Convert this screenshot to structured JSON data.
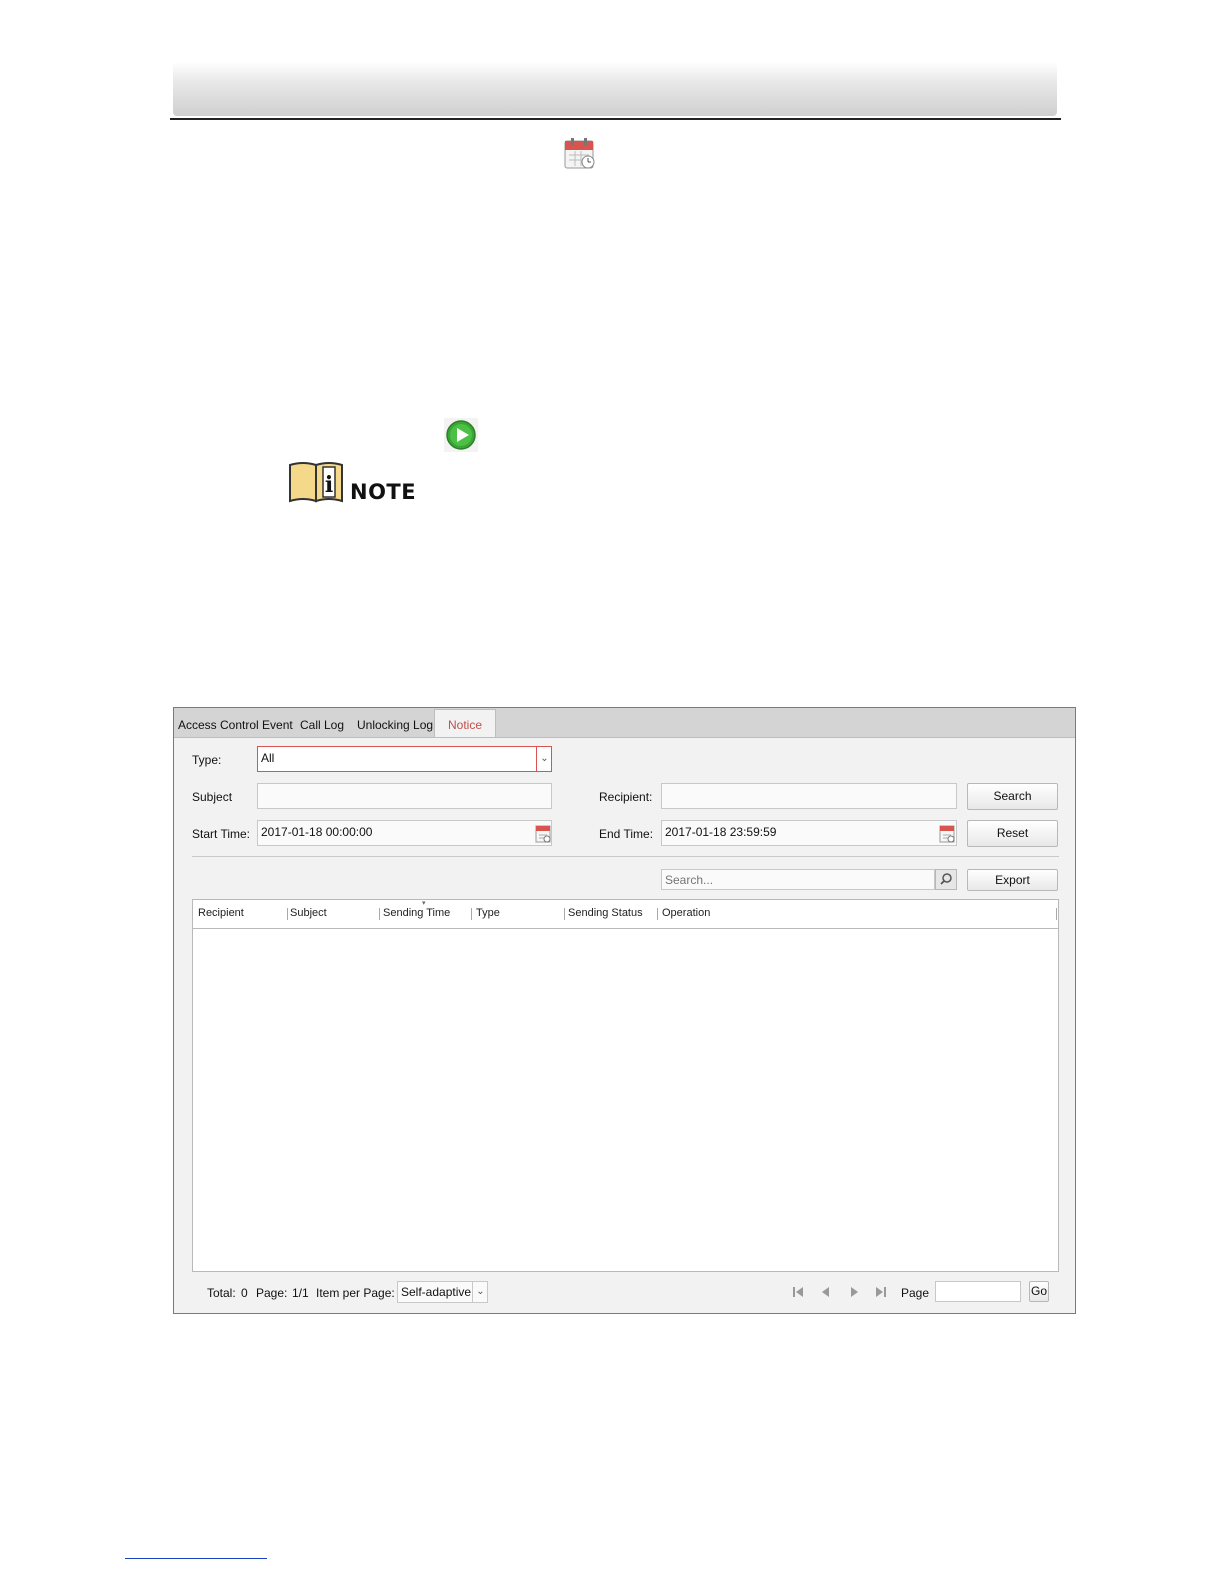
{
  "document": {
    "note_label": "NOTE"
  },
  "app": {
    "tabs": [
      {
        "label": "Access Control Event",
        "active": false
      },
      {
        "label": "Call Log",
        "active": false
      },
      {
        "label": "Unlocking Log",
        "active": false
      },
      {
        "label": "Notice",
        "active": true
      }
    ],
    "filters": {
      "type_label": "Type:",
      "type_value": "All",
      "subject_label": "Subject",
      "subject_value": "",
      "recipient_label": "Recipient:",
      "recipient_value": "",
      "start_time_label": "Start Time:",
      "start_time_value": "2017-01-18 00:00:00",
      "end_time_label": "End Time:",
      "end_time_value": "2017-01-18 23:59:59",
      "search_button": "Search",
      "reset_button": "Reset"
    },
    "table_toolbar": {
      "search_placeholder": "Search...",
      "export_button": "Export"
    },
    "table": {
      "columns": [
        "Recipient",
        "Subject",
        "Sending Time",
        "Type",
        "Sending Status",
        "Operation"
      ],
      "sorted_column": "Sending Time",
      "rows": []
    },
    "pager": {
      "total_label": "Total:",
      "total_value": "0",
      "page_label": "Page:",
      "page_value": "1/1",
      "items_per_page_label": "Item per Page:",
      "items_per_page_value": "Self-adaptive",
      "goto_label": "Page",
      "goto_value": "",
      "go_button": "Go"
    },
    "colors": {
      "active_tab": "#c0504d",
      "type_field_border": "#d9534f",
      "calendar_icon": "#d9534f",
      "play_icon": "#3aa635",
      "note_icon": "#f5d98a"
    }
  }
}
